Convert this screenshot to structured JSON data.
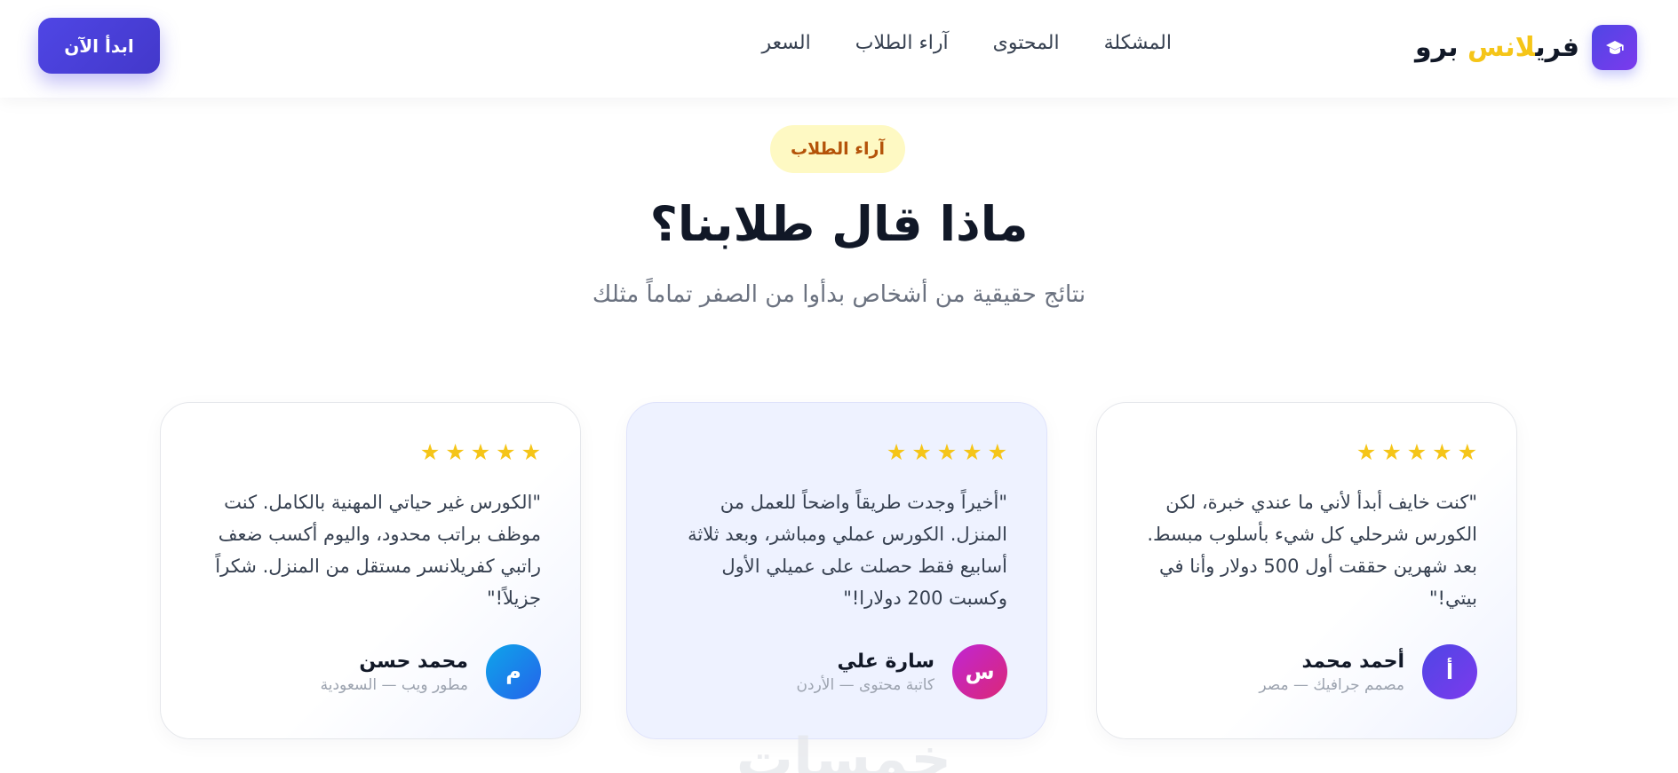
{
  "navbar": {
    "logo": {
      "text_main": "فري",
      "text_accent": "لانس",
      "text_end": " برو",
      "icon": "graduation-cap-icon"
    },
    "links": [
      "المشكلة",
      "المحتوى",
      "آراء الطلاب",
      "السعر"
    ],
    "cta_label": "ابدأ الآن"
  },
  "section": {
    "badge": "آراء الطلاب",
    "title": "ماذا قال طلابنا؟",
    "subtitle": "نتائج حقيقية من أشخاص بدأوا من الصفر تماماً مثلك"
  },
  "testimonials": [
    {
      "rating": 5,
      "quote": "\"كنت خايف أبدأ لأني ما عندي خبرة، لكن الكورس شرحلي كل شيء بأسلوب مبسط. بعد شهرين حققت أول 500 دولار وأنا في بيتي!\"",
      "avatar_letter": "أ",
      "name": "أحمد محمد",
      "role": "مصمم جرافيك — مصر"
    },
    {
      "rating": 5,
      "quote": "\"أخيراً وجدت طريقاً واضحاً للعمل من المنزل. الكورس عملي ومباشر، وبعد ثلاثة أسابيع فقط حصلت على عميلي الأول وكسبت 200 دولارا!\"",
      "avatar_letter": "س",
      "name": "سارة علي",
      "role": "كاتبة محتوى — الأردن"
    },
    {
      "rating": 5,
      "quote": "\"الكورس غير حياتي المهنية بالكامل. كنت موظف براتب محدود، واليوم أكسب ضعف راتبي كفريلانسر مستقل من المنزل. شكراً جزيلاً!\"",
      "avatar_letter": "م",
      "name": "محمد حسن",
      "role": "مطور ويب — السعودية"
    }
  ],
  "watermark": "خمسات",
  "colors": {
    "primary": "#4f46e5",
    "star": "#f5c518",
    "badge_bg": "#fef9c3",
    "badge_text": "#b45309"
  }
}
